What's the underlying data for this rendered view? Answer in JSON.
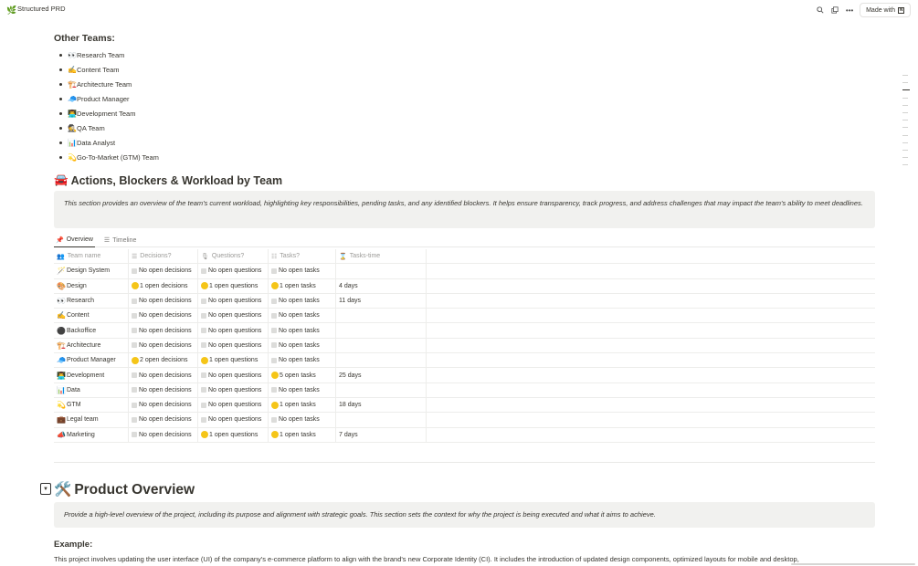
{
  "app": {
    "title": "Structured PRD",
    "logo_icon": "leaf-icon",
    "made_with": "Made with"
  },
  "other_teams": {
    "heading": "Other Teams:",
    "items": [
      {
        "emoji": "👀",
        "label": "Research Team"
      },
      {
        "emoji": "✍️",
        "label": "Content Team"
      },
      {
        "emoji": "🏗️",
        "label": "Architecture Team"
      },
      {
        "emoji": "🧢",
        "label": "Product Manager"
      },
      {
        "emoji": "👨‍💻",
        "label": "Development Team"
      },
      {
        "emoji": "🕵️",
        "label": "QA Team"
      },
      {
        "emoji": "📊",
        "label": "Data Analyst"
      },
      {
        "emoji": "💫",
        "label": "Go-To-Market (GTM) Team"
      }
    ]
  },
  "section_actions": {
    "emoji": "🚘",
    "heading": "Actions, Blockers & Workload by Team",
    "callout": "This section provides an overview of the team's current workload, highlighting key responsibilities, pending tasks, and any identified blockers. It helps ensure transparency, track progress, and address challenges that may impact the team's ability to meet deadlines."
  },
  "view_tabs": [
    {
      "label": "Overview",
      "icon": "pin-icon",
      "active": true
    },
    {
      "label": "Timeline",
      "icon": "timeline-icon",
      "active": false
    }
  ],
  "table": {
    "headers": [
      "Team name",
      "Decisions?",
      "Questions?",
      "Tasks?",
      "Tasks-time"
    ],
    "rows": [
      {
        "emoji": "🪄",
        "team": "Design System",
        "decisions": "No open decisions",
        "d_open": false,
        "questions": "No open questions",
        "q_open": false,
        "tasks": "No open tasks",
        "t_open": false,
        "time": ""
      },
      {
        "emoji": "🎨",
        "team": "Design",
        "decisions": "1 open decisions",
        "d_open": true,
        "questions": "1 open questions",
        "q_open": true,
        "tasks": "1 open tasks",
        "t_open": true,
        "time": "4 days"
      },
      {
        "emoji": "👀",
        "team": "Research",
        "decisions": "No open decisions",
        "d_open": false,
        "questions": "No open questions",
        "q_open": false,
        "tasks": "No open tasks",
        "t_open": false,
        "time": "11 days"
      },
      {
        "emoji": "✍️",
        "team": "Content",
        "decisions": "No open decisions",
        "d_open": false,
        "questions": "No open questions",
        "q_open": false,
        "tasks": "No open tasks",
        "t_open": false,
        "time": ""
      },
      {
        "emoji": "⚫",
        "team": "Backoffice",
        "decisions": "No open decisions",
        "d_open": false,
        "questions": "No open questions",
        "q_open": false,
        "tasks": "No open tasks",
        "t_open": false,
        "time": ""
      },
      {
        "emoji": "🏗️",
        "team": "Architecture",
        "decisions": "No open decisions",
        "d_open": false,
        "questions": "No open questions",
        "q_open": false,
        "tasks": "No open tasks",
        "t_open": false,
        "time": ""
      },
      {
        "emoji": "🧢",
        "team": "Product Manager",
        "decisions": "2 open decisions",
        "d_open": true,
        "questions": "1 open questions",
        "q_open": true,
        "tasks": "No open tasks",
        "t_open": false,
        "time": ""
      },
      {
        "emoji": "👨‍💻",
        "team": "Development",
        "decisions": "No open decisions",
        "d_open": false,
        "questions": "No open questions",
        "q_open": false,
        "tasks": "5 open tasks",
        "t_open": true,
        "time": "25 days"
      },
      {
        "emoji": "📊",
        "team": "Data",
        "decisions": "No open decisions",
        "d_open": false,
        "questions": "No open questions",
        "q_open": false,
        "tasks": "No open tasks",
        "t_open": false,
        "time": ""
      },
      {
        "emoji": "💫",
        "team": "GTM",
        "decisions": "No open decisions",
        "d_open": false,
        "questions": "No open questions",
        "q_open": false,
        "tasks": "1 open tasks",
        "t_open": true,
        "time": "18 days"
      },
      {
        "emoji": "💼",
        "team": "Legal team",
        "decisions": "No open decisions",
        "d_open": false,
        "questions": "No open questions",
        "q_open": false,
        "tasks": "No open tasks",
        "t_open": false,
        "time": ""
      },
      {
        "emoji": "📣",
        "team": "Marketing",
        "decisions": "No open decisions",
        "d_open": false,
        "questions": "1 open questions",
        "q_open": true,
        "tasks": "1 open tasks",
        "t_open": true,
        "time": "7 days"
      }
    ]
  },
  "section_product": {
    "emoji": "🛠️",
    "toggle_icon": "toggle-down-icon",
    "heading": "Product Overview",
    "callout": "Provide a high-level overview of the project, including its purpose and alignment with strategic goals. This section sets the context for why the project is being executed and what it aims to achieve.",
    "example_heading": "Example:",
    "paragraph": "This project involves updating the user interface (UI) of the company's e-commerce platform to align with the brand's new Corporate Identity (CI). It includes the introduction of updated design components, optimized layouts for mobile and desktop,"
  },
  "colors": {
    "accent_dot": "#f5c518",
    "callout_bg": "#f1f1ef",
    "text": "#37352f"
  }
}
